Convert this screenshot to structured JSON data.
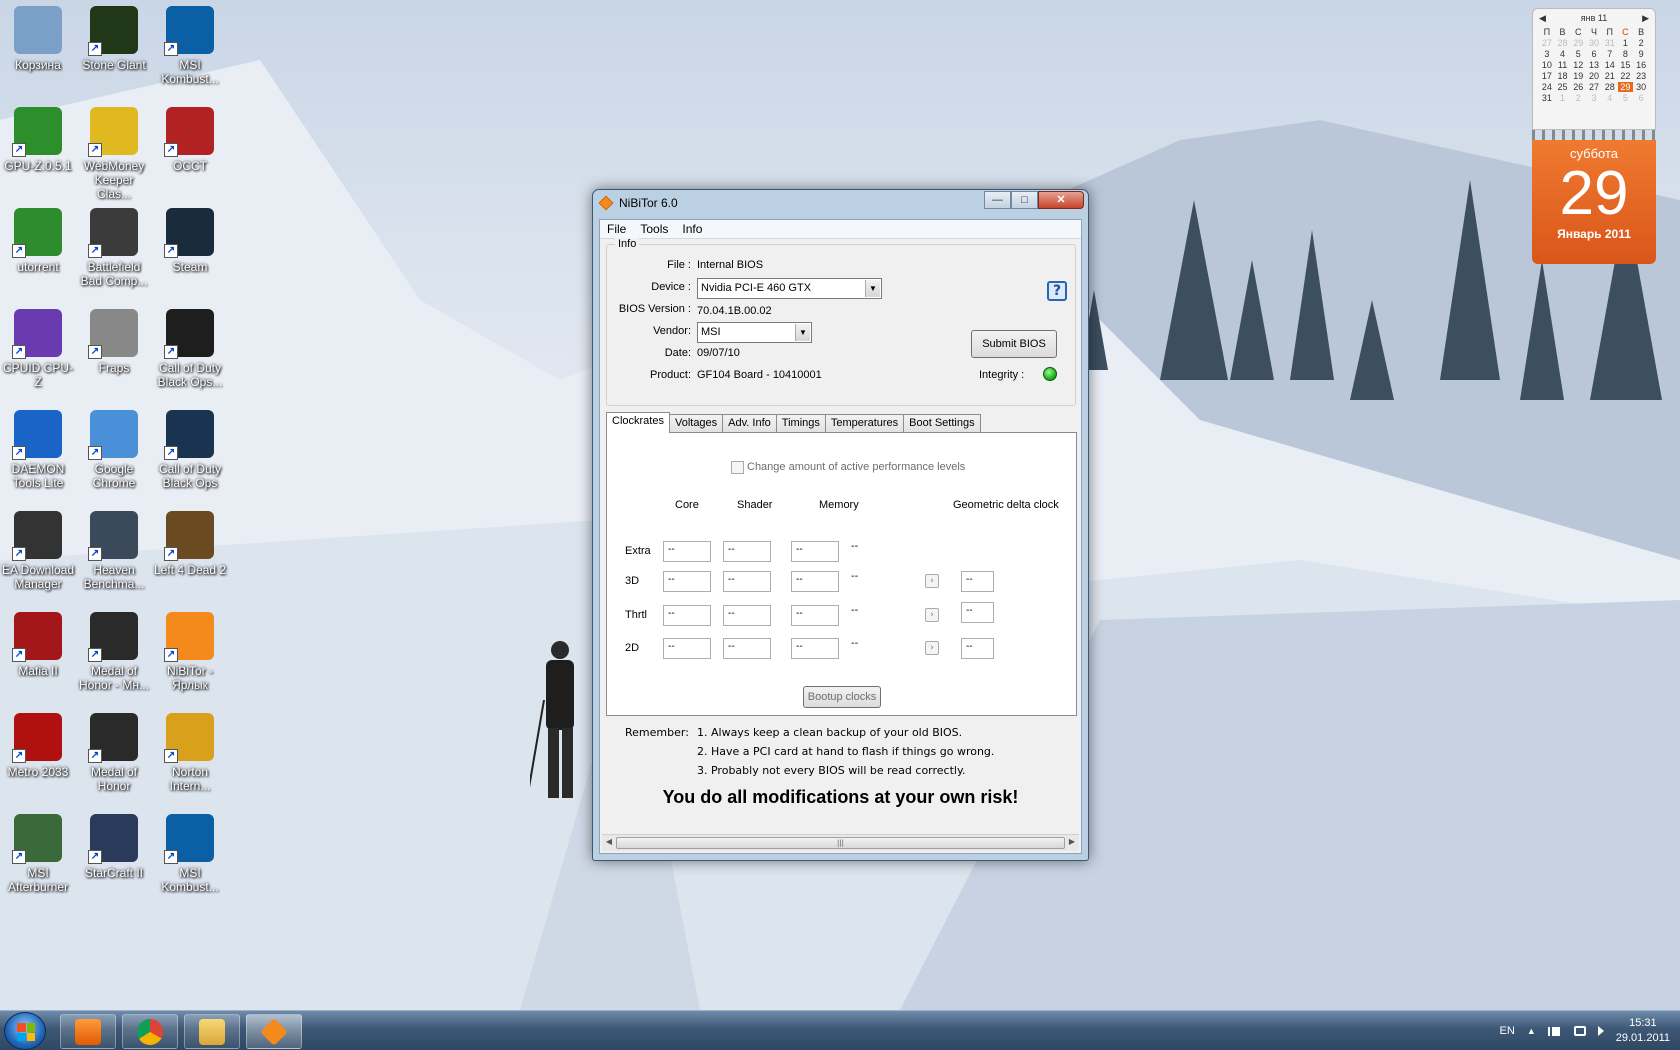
{
  "desktop": {
    "icons": [
      {
        "label": "Корзина"
      },
      {
        "label": "Stone Giant"
      },
      {
        "label": "MSI Kombust..."
      },
      {
        "label": "GPU-Z.0.5.1"
      },
      {
        "label": "WebMoney Keeper Clas..."
      },
      {
        "label": "OCCT"
      },
      {
        "label": "utorrent"
      },
      {
        "label": "Battlefield Bad Comp..."
      },
      {
        "label": "Steam"
      },
      {
        "label": "CPUID CPU-Z"
      },
      {
        "label": "Fraps"
      },
      {
        "label": "Call of Duty Black Ops..."
      },
      {
        "label": "DAEMON Tools Lite"
      },
      {
        "label": "Google Chrome"
      },
      {
        "label": "Call of Duty Black Ops"
      },
      {
        "label": "EA Download Manager"
      },
      {
        "label": "Heaven Benchma..."
      },
      {
        "label": "Left 4 Dead 2"
      },
      {
        "label": "Mafia II"
      },
      {
        "label": "Medal of Honor - Мн..."
      },
      {
        "label": "NiBiTor - Ярлык"
      },
      {
        "label": "Metro 2033"
      },
      {
        "label": "Medal of Honor"
      },
      {
        "label": "Norton Intern..."
      },
      {
        "label": "MSI Afterburner"
      },
      {
        "label": "StarCraft II"
      },
      {
        "label": "MSI Kombust..."
      }
    ]
  },
  "calendar": {
    "month": "янв 11",
    "prev": "◀",
    "next": "▶",
    "weekdays": [
      "П",
      "В",
      "С",
      "Ч",
      "П",
      "С",
      "В"
    ],
    "days": [
      [
        "27",
        "28",
        "29",
        "30",
        "31",
        "1",
        "2"
      ],
      [
        "3",
        "4",
        "5",
        "6",
        "7",
        "8",
        "9"
      ],
      [
        "10",
        "11",
        "12",
        "13",
        "14",
        "15",
        "16"
      ],
      [
        "17",
        "18",
        "19",
        "20",
        "21",
        "22",
        "23"
      ],
      [
        "24",
        "25",
        "26",
        "27",
        "28",
        "29",
        "30"
      ],
      [
        "31",
        "1",
        "2",
        "3",
        "4",
        "5",
        "6"
      ]
    ],
    "dow": "суббота",
    "day": "29",
    "month_year": "Январь 2011"
  },
  "window": {
    "title": "NiBiTor 6.0",
    "minimize": "—",
    "maximize": "□",
    "close": "✕",
    "menu": {
      "file": "File",
      "tools": "Tools",
      "info": "Info"
    },
    "info_group": "Info",
    "file_label": "File :",
    "file_value": "Internal BIOS",
    "device_label": "Device :",
    "device_value": "Nvidia PCI-E 460 GTX",
    "bios_label": "BIOS Version :",
    "bios_value": "70.04.1B.00.02",
    "vendor_label": "Vendor:",
    "vendor_value": "MSI",
    "date_label": "Date:",
    "date_value": "09/07/10",
    "product_label": "Product:",
    "product_value": "GF104 Board - 10410001",
    "help": "?",
    "submit": "Submit BIOS",
    "integrity_label": "Integrity :",
    "tabs": [
      "Clockrates",
      "Voltages",
      "Adv. Info",
      "Timings",
      "Temperatures",
      "Boot Settings"
    ],
    "change_levels": "Change amount of active performance levels",
    "col_core": "Core",
    "col_shader": "Shader",
    "col_memory": "Memory",
    "col_geo": "Geometric delta clock",
    "rows": [
      "Extra",
      "3D",
      "Thrtl",
      "2D"
    ],
    "field_value": "--",
    "arrow_btn": "›",
    "bootup": "Bootup clocks",
    "remember_label": "Remember:",
    "remember_1": "1. Always keep a clean backup of your old BIOS.",
    "remember_2": "2. Have a PCI card at hand to flash if things go wrong.",
    "remember_3": "3. Probably not every BIOS will be read correctly.",
    "risk": "You do all modifications at your own risk!",
    "scroll_grip": "|||",
    "scroll_left": "◀",
    "scroll_right": "▶"
  },
  "taskbar": {
    "lang": "EN",
    "time": "15:31",
    "date": "29.01.2011",
    "tray_up": "▲"
  },
  "colors": {
    "accent": "#f48a1c",
    "integrity_ok": "#1eb41e"
  }
}
